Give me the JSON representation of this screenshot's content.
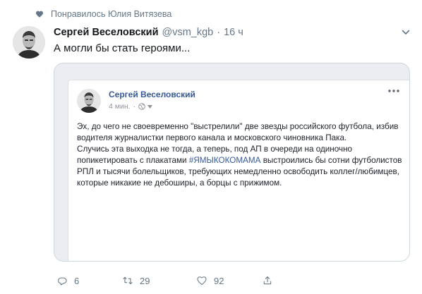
{
  "social_context": {
    "icon": "heart-icon",
    "text": "Понравилось Юлия Витязева"
  },
  "tweet": {
    "author_name": "Сергей Веселовский",
    "handle": "@vsm_kgb",
    "dot": "·",
    "time": "16 ч",
    "text": "А могли бы стать героями..."
  },
  "fb_post": {
    "author_name": "Сергей Веселовский",
    "time": "4 мин.",
    "dot": "·",
    "paragraph1": "Эх, до чего не своевременно \"выстрелили\" две звезды российского футбола, избив водителя журналистки первого канала и московского чиновника Пака.",
    "paragraph2_before": "Случись эта выходка не тогда, а теперь, под АП в очереди на одиночно попикетировать с плакатами ",
    "hashtag": "#ЯМЫКОКОМАМА",
    "paragraph2_after": " выстроились бы сотни футболистов РПЛ и тысячи болельщиков, требующих немедленно освободить коллег/любимцев, которые никакие не дебоширы, а борцы с прижимом."
  },
  "actions": {
    "replies": "6",
    "retweets": "29",
    "likes": "92"
  },
  "colors": {
    "link_blue": "#365899",
    "secondary_text": "#657786",
    "border": "#ccd6dd"
  }
}
